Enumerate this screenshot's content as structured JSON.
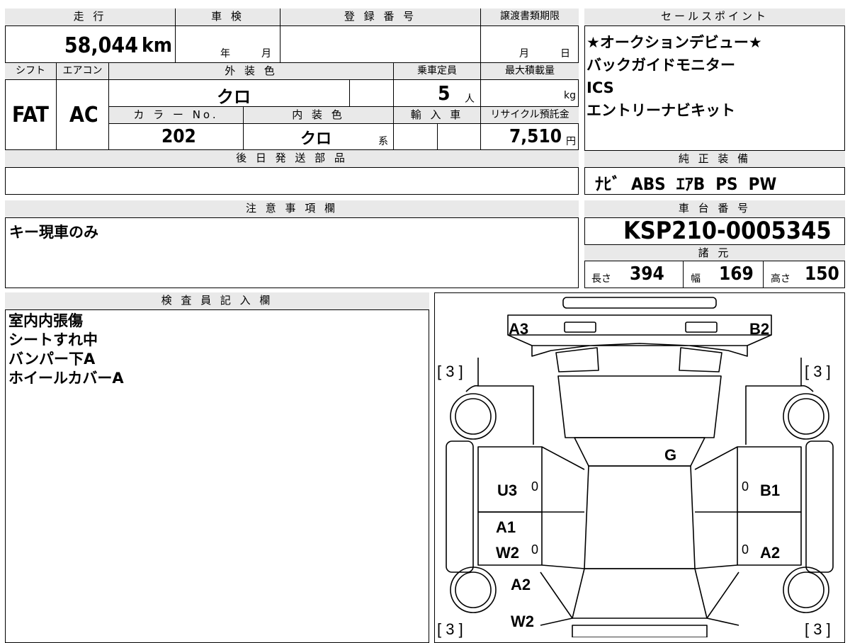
{
  "top": {
    "hdr_mileage": "走 行",
    "hdr_inspection": "車 検",
    "hdr_registration": "登 録 番 号",
    "hdr_transfer": "譲渡書類期限",
    "mileage": "58,044",
    "mileage_unit": "km",
    "insp_year": "年",
    "insp_month": "月",
    "transfer_month": "月",
    "transfer_day": "日",
    "hdr_shift": "シフト",
    "hdr_aircon": "エアコン",
    "hdr_exterior": "外 装 色",
    "hdr_capacity": "乗車定員",
    "hdr_load": "最大積載量",
    "shift": "FAT",
    "aircon": "AC",
    "exterior_color": "クロ",
    "capacity": "5",
    "capacity_unit": "人",
    "load_unit": "kg",
    "hdr_color_no": "カ ラ ー No.",
    "hdr_interior": "内 装 色",
    "hdr_import": "輸 入 車",
    "hdr_recycle": "リサイクル預託金",
    "color_no": "202",
    "interior_color": "クロ",
    "interior_suffix": "系",
    "recycle_fee": "7,510",
    "recycle_unit": "円",
    "hdr_later_parts": "後 日 発 送 部 品"
  },
  "sales": {
    "title": "セールスポイント",
    "items": [
      "★オークションデビュー★",
      "バックガイドモニター",
      "ICS",
      "エントリーナビキット"
    ]
  },
  "equipment": {
    "title": "純 正 装 備",
    "value": "ﾅﾋﾞ  ABS  ｴｱB  PS  PW"
  },
  "notes": {
    "title": "注 意 事 項 欄",
    "text": "キー現車のみ"
  },
  "chassis": {
    "title": "車 台 番 号",
    "number": "KSP210-0005345",
    "spec_title": "諸 元",
    "length_label": "長さ",
    "length": "394",
    "width_label": "幅",
    "width": "169",
    "height_label": "高さ",
    "height": "150"
  },
  "inspector": {
    "title": "検 査 員 記 入 欄",
    "lines": [
      "室内内張傷",
      "シートすれ中",
      "バンパー下A",
      "ホイールカバーA"
    ]
  },
  "diagram": {
    "front_left": "A3",
    "front_right": "B2",
    "tire_tl": "[ 3 ]",
    "tire_tr": "[ 3 ]",
    "tire_bl": "[ 3 ]",
    "tire_br": "[ 3 ]",
    "glass": "G",
    "door_fl": "U3",
    "door_fr": "B1",
    "door_rl_1": "A1",
    "door_rl_2": "W2",
    "door_rr": "A2",
    "fender_rl": "A2",
    "bumper_rl": "W2",
    "zero1": "0",
    "zero2": "0",
    "zero3": "0",
    "zero4": "0"
  }
}
